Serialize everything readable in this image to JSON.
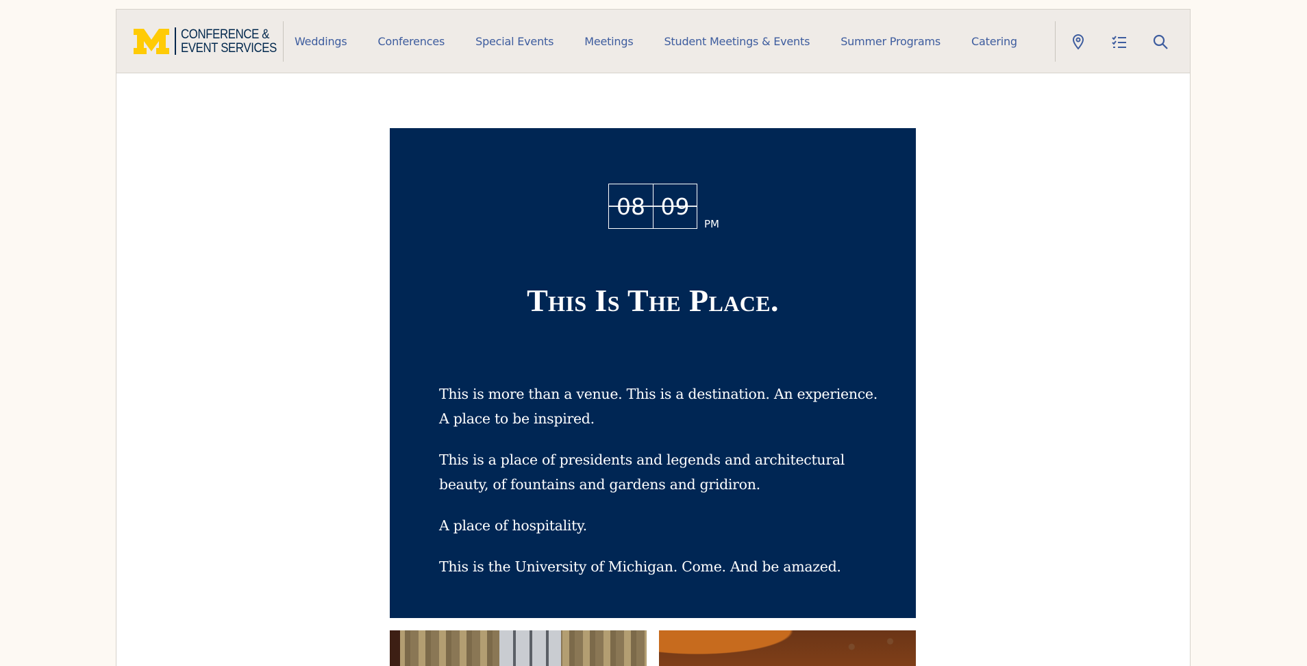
{
  "header": {
    "logo_line1": "CONFERENCE &",
    "logo_line2": "EVENT SERVICES",
    "nav": [
      {
        "label": "Weddings"
      },
      {
        "label": "Conferences"
      },
      {
        "label": "Special Events"
      },
      {
        "label": "Meetings"
      },
      {
        "label": "Student Meetings & Events"
      },
      {
        "label": "Summer Programs"
      },
      {
        "label": "Catering"
      }
    ],
    "icons": [
      "location-pin-icon",
      "checklist-icon",
      "search-icon"
    ]
  },
  "hero": {
    "clock": {
      "hours": "08",
      "minutes": "09",
      "ampm": "PM"
    },
    "title": "This Is The Place.",
    "paragraphs": [
      "This is more than a venue. This is a destination. An experience. A place to be inspired.",
      "This is a place of presidents and legends and architectural beauty, of fountains and gardens and gridiron.",
      "A place of hospitality.",
      "This is the University of Michigan. Come. And be amazed."
    ]
  },
  "colors": {
    "maize": "#ffcb05",
    "blue": "#00274c",
    "hero_bg": "#002654",
    "nav_link": "#3d5c9e",
    "header_bg": "#efebe7",
    "page_bg": "#fdf9f3"
  }
}
